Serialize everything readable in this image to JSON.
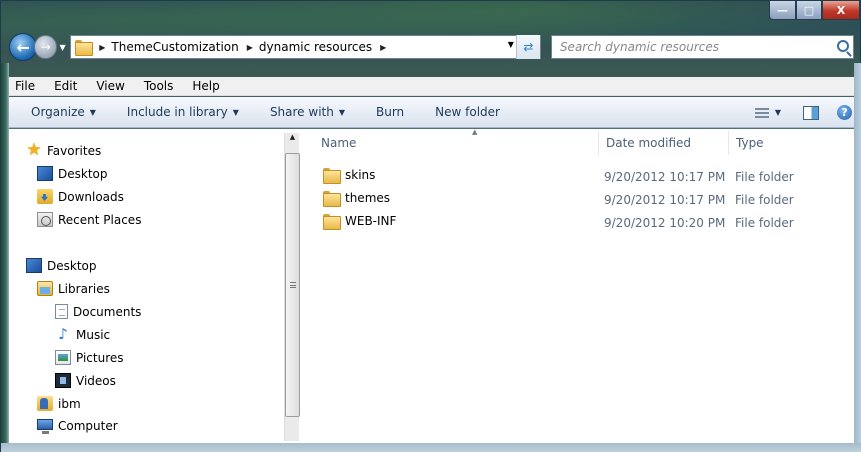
{
  "window": {
    "caption": {
      "minimize": "—",
      "maximize": "□",
      "close": "X"
    }
  },
  "address": {
    "crumbs": [
      "ThemeCustomization",
      "dynamic resources"
    ],
    "search_placeholder": "Search dynamic resources"
  },
  "menu": [
    "File",
    "Edit",
    "View",
    "Tools",
    "Help"
  ],
  "commands": {
    "organize": "Organize",
    "include": "Include in library",
    "share": "Share with",
    "burn": "Burn",
    "new_folder": "New folder",
    "help": "?"
  },
  "nav": {
    "favorites": {
      "label": "Favorites",
      "icon": "star-icon"
    },
    "items": [
      {
        "label": "Desktop",
        "icon": "desktop-icon"
      },
      {
        "label": "Downloads",
        "icon": "downloads-icon"
      },
      {
        "label": "Recent Places",
        "icon": "recent-places-icon"
      },
      {
        "label": "Desktop",
        "icon": "desktop-icon"
      },
      {
        "label": "Libraries",
        "icon": "libraries-icon"
      },
      {
        "label": "Documents",
        "icon": "documents-icon"
      },
      {
        "label": "Music",
        "icon": "music-icon"
      },
      {
        "label": "Pictures",
        "icon": "pictures-icon"
      },
      {
        "label": "Videos",
        "icon": "videos-icon"
      },
      {
        "label": "ibm",
        "icon": "user-folder-icon"
      },
      {
        "label": "Computer",
        "icon": "computer-icon"
      }
    ]
  },
  "columns": {
    "name": "Name",
    "date": "Date modified",
    "type": "Type"
  },
  "files": [
    {
      "name": "skins",
      "date": "9/20/2012 10:17 PM",
      "type": "File folder"
    },
    {
      "name": "themes",
      "date": "9/20/2012 10:17 PM",
      "type": "File folder"
    },
    {
      "name": "WEB-INF",
      "date": "9/20/2012 10:20 PM",
      "type": "File folder"
    }
  ]
}
